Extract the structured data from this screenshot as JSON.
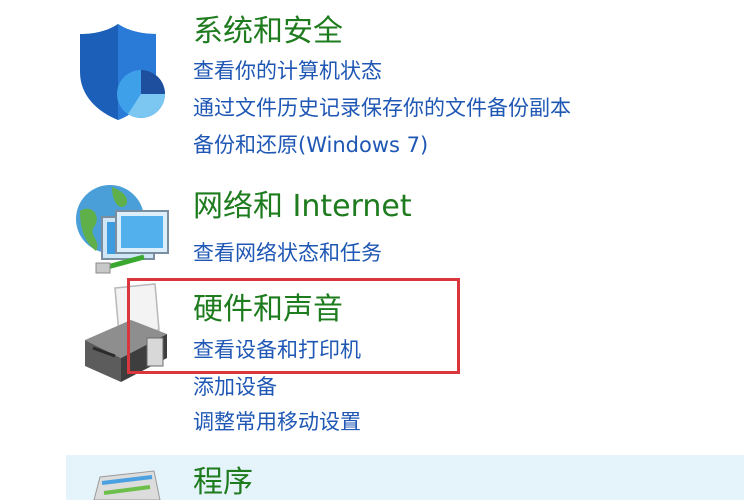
{
  "categories": [
    {
      "title": "系统和安全",
      "icon": "shield-icon",
      "links": [
        "查看你的计算机状态",
        "通过文件历史记录保存你的文件备份副本",
        "备份和还原(Windows 7)"
      ]
    },
    {
      "title": "网络和 Internet",
      "icon": "network-globe-icon",
      "links": [
        "查看网络状态和任务"
      ]
    },
    {
      "title": "硬件和声音",
      "icon": "printer-icon",
      "links": [
        "查看设备和打印机",
        "添加设备",
        "调整常用移动设置"
      ]
    },
    {
      "title": "程序",
      "icon": "programs-icon",
      "links": []
    }
  ],
  "colors": {
    "title_green": "#1e7b1e",
    "link_blue": "#1f57b4",
    "highlight_red": "#d9363e",
    "hover_bg": "#e5f3fb"
  }
}
